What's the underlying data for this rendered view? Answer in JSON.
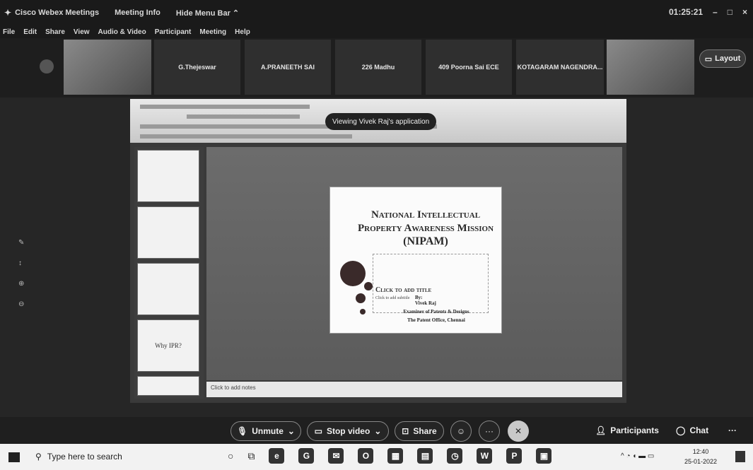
{
  "titlebar": {
    "app": "Cisco Webex Meetings",
    "meeting_info": "Meeting Info",
    "hide_menu": "Hide Menu Bar",
    "timer": "01:25:21"
  },
  "menu": [
    "File",
    "Edit",
    "Share",
    "View",
    "Audio & Video",
    "Participant",
    "Meeting",
    "Help"
  ],
  "participants": [
    "G.Thejeswar",
    "A.PRANEETH SAI",
    "226 Madhu",
    "409 Poorna Sai ECE",
    "KOTAGARAM NAGENDRA..."
  ],
  "layout_label": "Layout",
  "share": {
    "viewing": "Viewing Vivek Raj's application",
    "notes": "Click to add notes",
    "thumb4": "Why IPR?"
  },
  "slide": {
    "title_line1": "National Intellectual",
    "title_line2": "Property Awareness Mission",
    "acronym": "(NIPAM)",
    "cta": "Click to add title",
    "subtitle": "Click to add subtitle",
    "by": "By:",
    "name": "Vivek Raj",
    "role": "Examiner of Patents & Designs",
    "office": "The Patent Office, Chennai"
  },
  "controls": {
    "unmute": "Unmute",
    "stop_video": "Stop video",
    "share": "Share",
    "participants": "Participants",
    "chat": "Chat"
  },
  "taskbar": {
    "search": "Type here to search",
    "time": "12:40",
    "date": "25-01-2022"
  }
}
